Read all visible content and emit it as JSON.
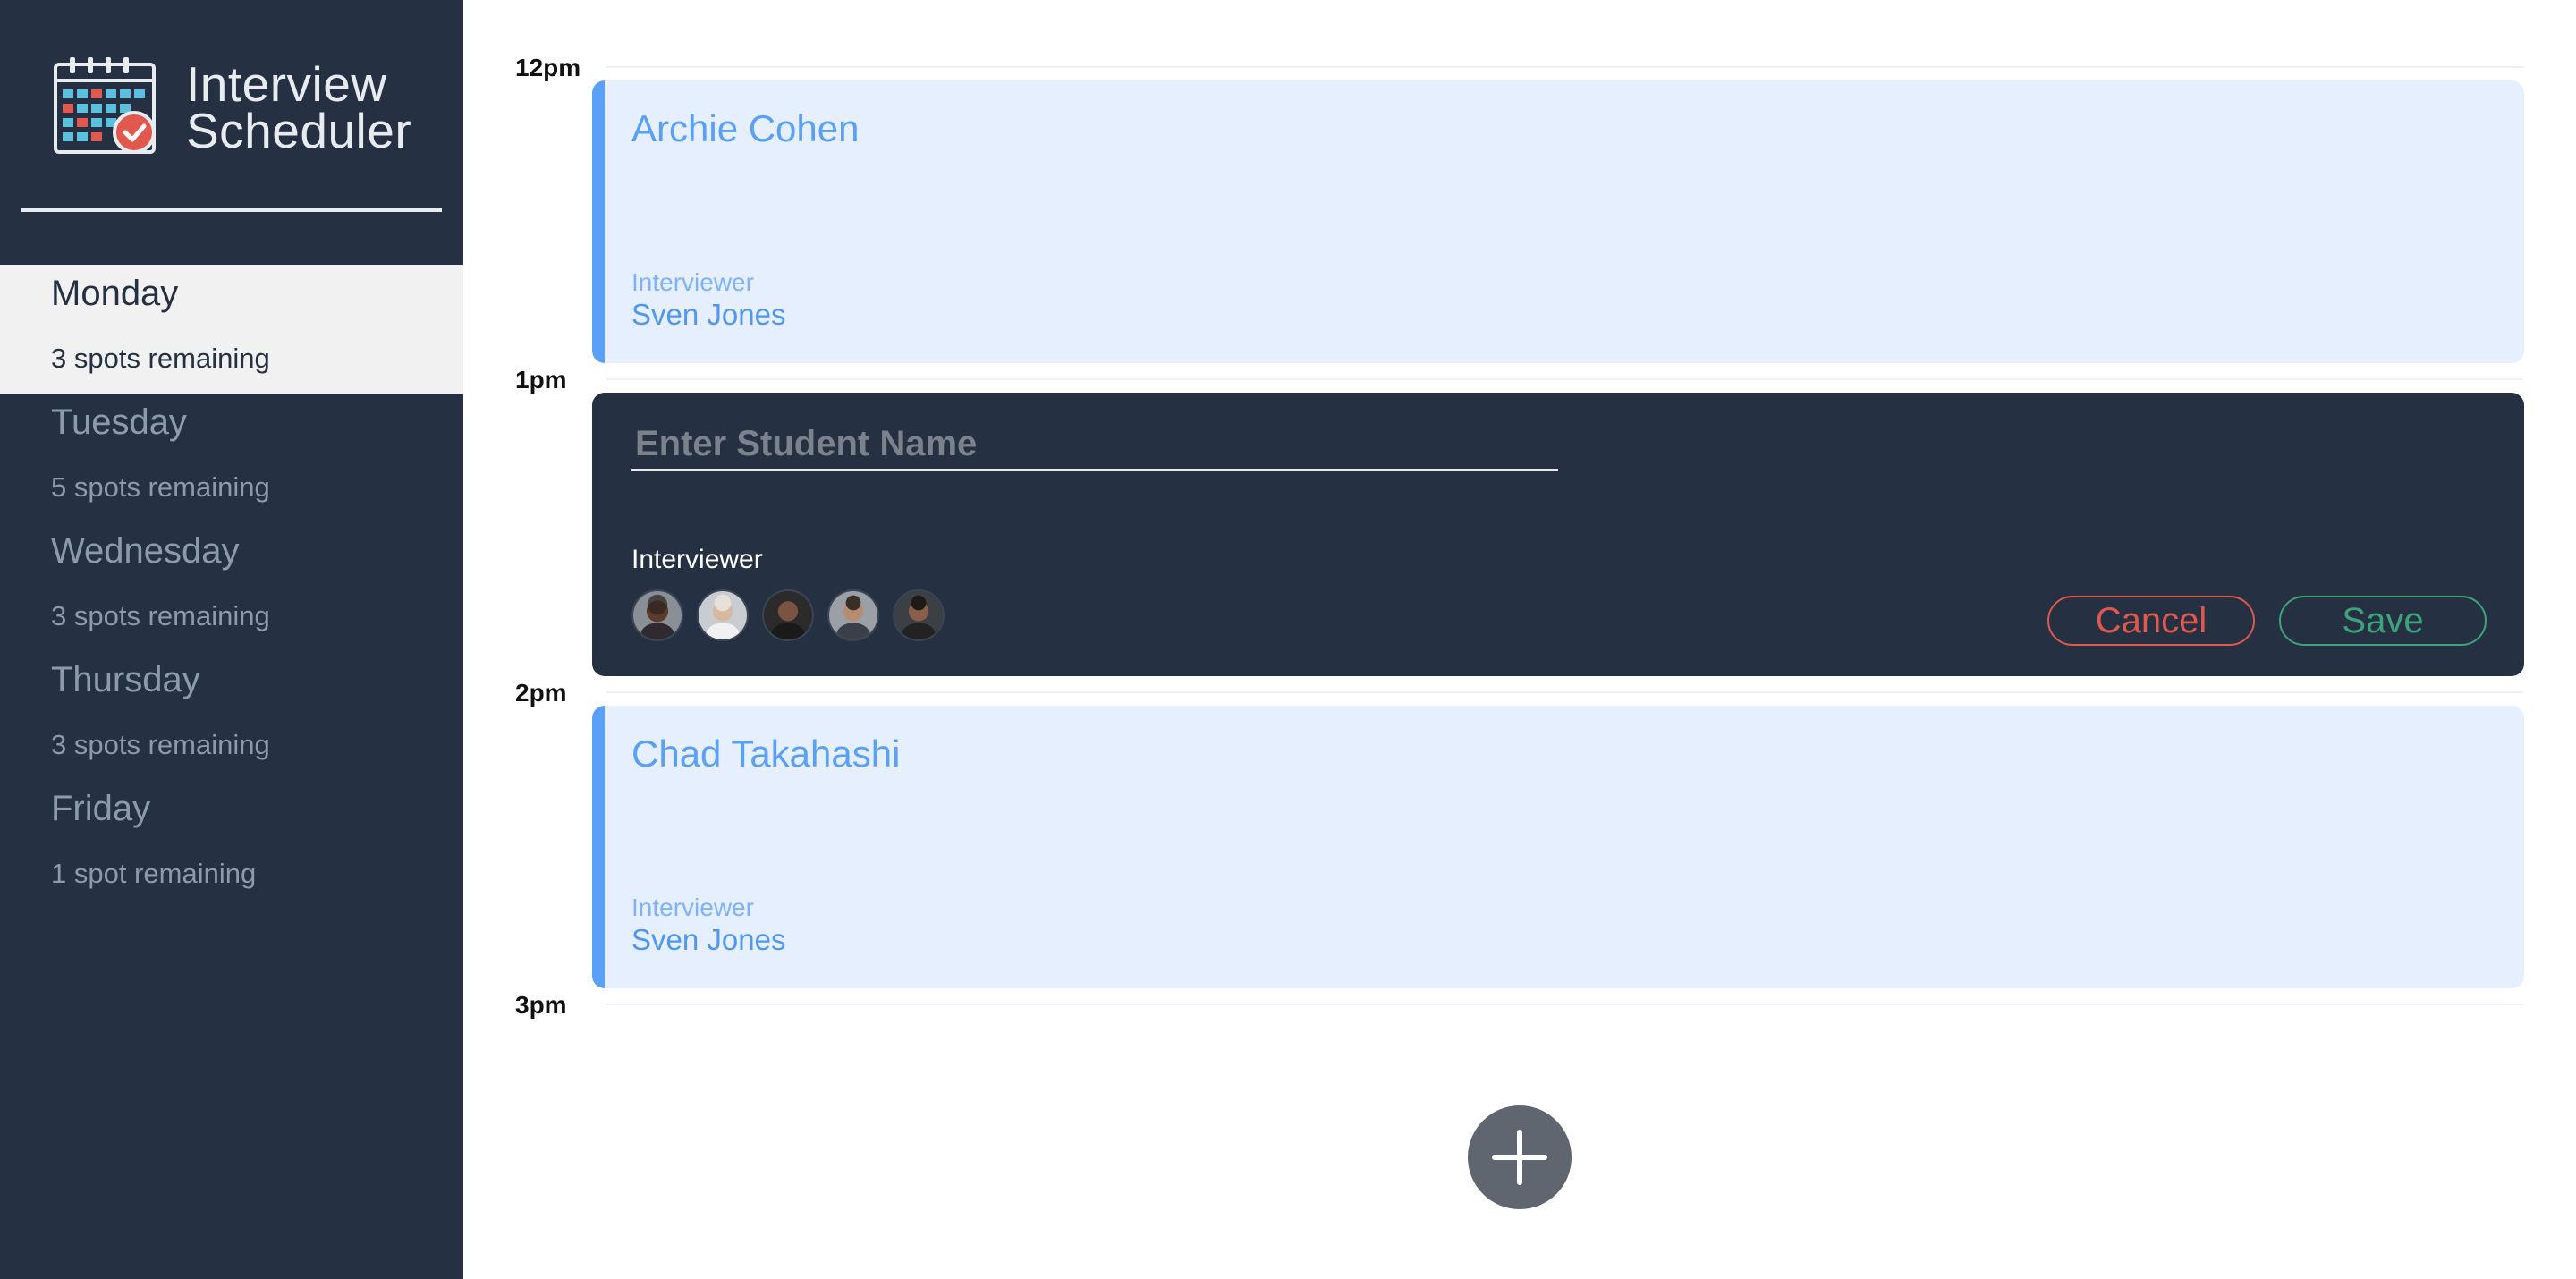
{
  "app": {
    "title_line1": "Interview",
    "title_line2": "Scheduler"
  },
  "days": [
    {
      "name": "Monday",
      "spots": "3 spots remaining",
      "selected": true
    },
    {
      "name": "Tuesday",
      "spots": "5 spots remaining",
      "selected": false
    },
    {
      "name": "Wednesday",
      "spots": "3 spots remaining",
      "selected": false
    },
    {
      "name": "Thursday",
      "spots": "3 spots remaining",
      "selected": false
    },
    {
      "name": "Friday",
      "spots": "1 spot remaining",
      "selected": false
    }
  ],
  "hours": [
    "12pm",
    "1pm",
    "2pm",
    "3pm"
  ],
  "appointments": [
    {
      "student": "Archie Cohen",
      "interviewer_label": "Interviewer",
      "interviewer": "Sven Jones"
    },
    {
      "student": "Chad Takahashi",
      "interviewer_label": "Interviewer",
      "interviewer": "Sven Jones"
    }
  ],
  "form": {
    "student_value": "",
    "student_placeholder": "Enter Student Name",
    "interviewer_label": "Interviewer",
    "avatars": [
      "interviewer-avatar-1",
      "interviewer-avatar-2",
      "interviewer-avatar-3",
      "interviewer-avatar-4",
      "interviewer-avatar-5"
    ],
    "cancel_label": "Cancel",
    "save_label": "Save"
  },
  "icons": {
    "logo": "calendar-check-icon",
    "add": "plus-icon"
  },
  "colors": {
    "sidebar": "#253142",
    "selected_day_bg": "#f1f1f1",
    "appointment_bg": "#e5effd",
    "appointment_accent": "#5aa0f7",
    "cancel": "#e0584e",
    "save": "#3ea37a",
    "add_button": "#5f6670"
  }
}
